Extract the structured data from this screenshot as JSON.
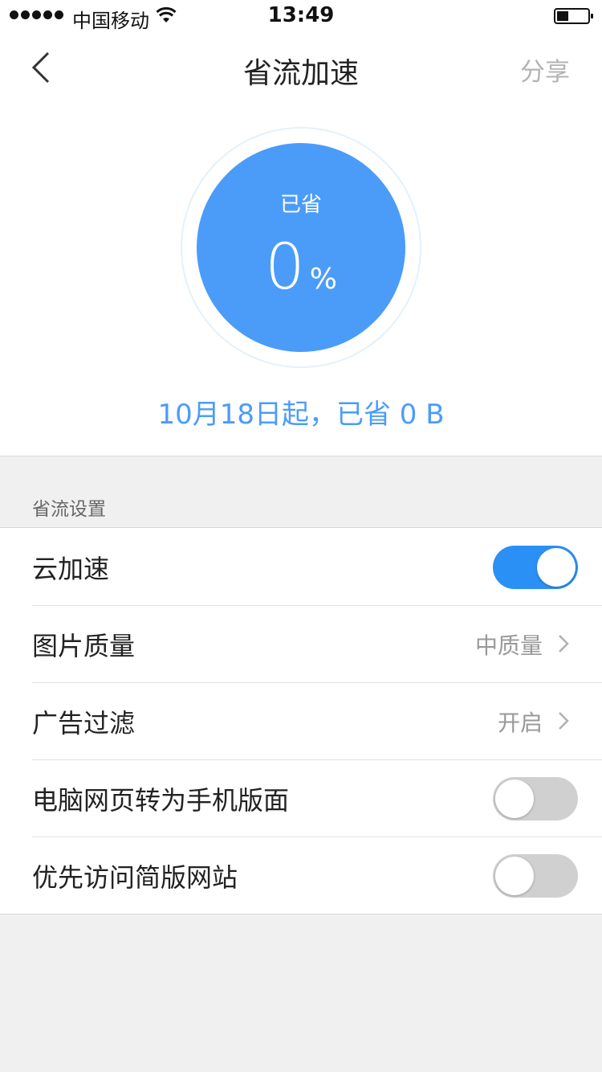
{
  "status_bar": {
    "carrier": "中国移动",
    "time": "13:49"
  },
  "nav": {
    "title": "省流加速",
    "share_label": "分享"
  },
  "savings": {
    "label": "已省",
    "percent": "0",
    "unit": "%",
    "summary": "10月18日起，已省 0 B"
  },
  "settings": {
    "section_title": "省流设置",
    "rows": [
      {
        "label": "云加速",
        "type": "toggle",
        "on": true
      },
      {
        "label": "图片质量",
        "type": "link",
        "value": "中质量"
      },
      {
        "label": "广告过滤",
        "type": "link",
        "value": "开启"
      },
      {
        "label": "电脑网页转为手机版面",
        "type": "toggle",
        "on": false
      },
      {
        "label": "优先访问简版网站",
        "type": "toggle",
        "on": false
      }
    ]
  },
  "colors": {
    "accent": "#4b9cf9",
    "toggle_on": "#2b90f5",
    "toggle_off": "#d0d0d0"
  }
}
